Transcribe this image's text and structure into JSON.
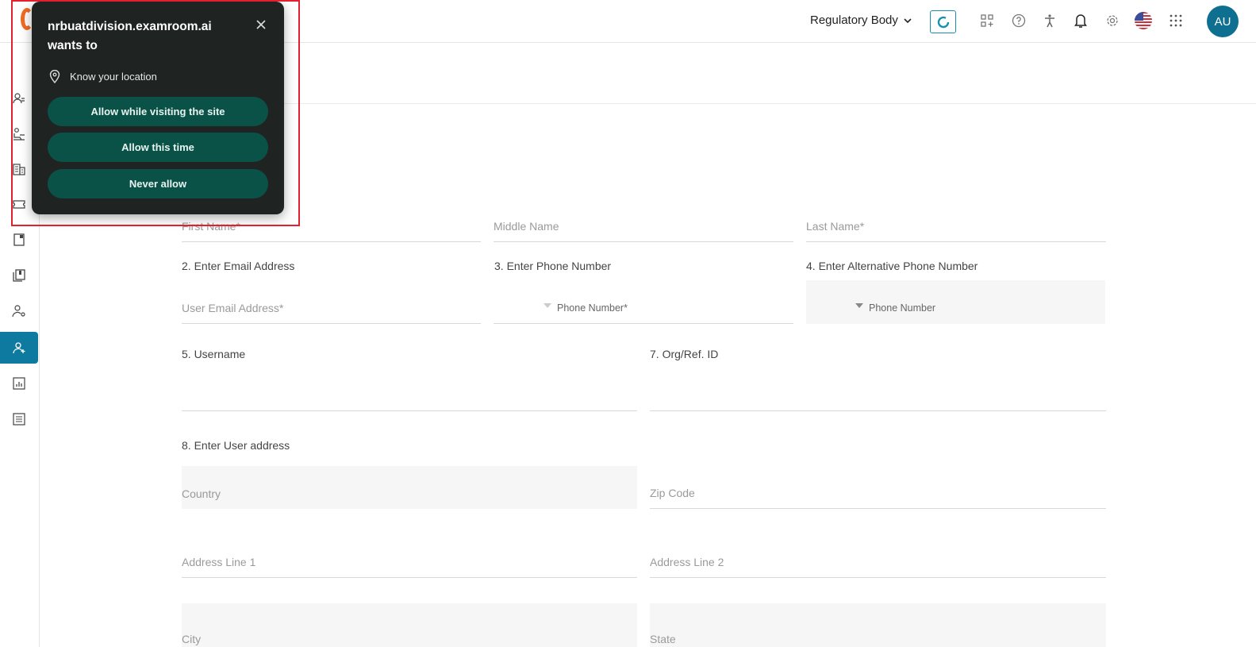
{
  "header": {
    "role_selector": "Regulatory Body",
    "avatar_initials": "AU"
  },
  "popup": {
    "title": "nrbuatdivision.examroom.ai wants to",
    "permission": "Know your location",
    "buttons": {
      "allow_visit": "Allow while visiting the site",
      "allow_once": "Allow this time",
      "never": "Never allow"
    }
  },
  "form": {
    "first_name": "First Name*",
    "middle_name": "Middle Name",
    "last_name": "Last Name*",
    "email_label": "2. Enter Email Address",
    "email_ph": "User Email Address*",
    "phone_label": "3. Enter Phone Number",
    "phone_ph": "Phone Number*",
    "alt_phone_label": "4. Enter Alternative Phone Number",
    "alt_phone_ph": "Phone Number",
    "username_label": "5. Username",
    "org_label": "7. Org/Ref. ID",
    "address_label": "8. Enter User address",
    "country": "Country",
    "zip": "Zip Code",
    "addr1": "Address Line 1",
    "addr2": "Address Line 2",
    "city": "City",
    "state": "State"
  },
  "colors": {
    "accent": "#0e7a9f",
    "popup_bg": "#1f2322",
    "popup_button": "#0a5248",
    "highlight": "#e3202b"
  }
}
